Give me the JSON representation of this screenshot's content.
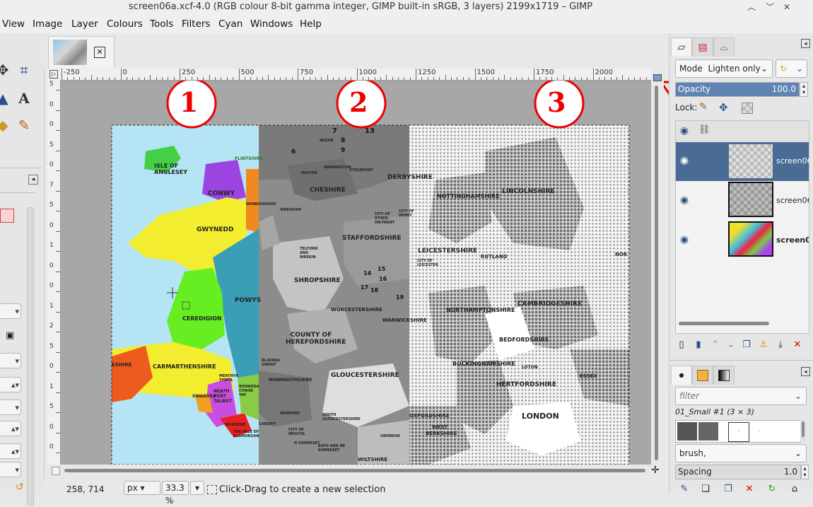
{
  "window": {
    "title": "screen06a.xcf-4.0 (RGB colour 8-bit gamma integer, GIMP built-in sRGB, 3 layers) 2199x1719 – GIMP",
    "buttons": [
      "︿",
      "﹀",
      "✕"
    ]
  },
  "menubar": [
    "View",
    "Image",
    "Layer",
    "Colours",
    "Tools",
    "Filters",
    "Cyan",
    "Windows",
    "Help"
  ],
  "ruler": {
    "h_ticks": [
      "-250",
      "0",
      "250",
      "500",
      "750",
      "1000",
      "1250",
      "1500",
      "1750",
      "2000",
      "2"
    ],
    "v_ticks": [
      "5",
      "0",
      "0",
      "5",
      "0",
      "7",
      "5",
      "0",
      "1",
      "0",
      "0",
      "1",
      "2",
      "5",
      "0",
      "1",
      "5",
      "0",
      "0"
    ]
  },
  "canvas": {
    "markers": [
      "1",
      "2",
      "3"
    ],
    "wales_labels": [
      "ISLE OF ANGLESEY",
      "CONWY",
      "GWYNEDD",
      "POWYS",
      "CEREDIGION",
      "CARMARTHENSHIRE",
      "FLINTSHIRE",
      "DENBIGHSHIRE",
      "SWANSEA",
      "NEATH PORT TALBOT",
      "RHONDDA CYNON TAF",
      "THE VALE OF GLAMORGAN",
      "BRIDGEND",
      "MERTHYR TYDFIL",
      "ESHIRE"
    ],
    "mid_labels": [
      "CHESHIRE",
      "DERBYSHIRE",
      "STAFFORDSHIRE",
      "SHROPSHIRE",
      "TELFORD AND WREKIN",
      "WORCESTERSHIRE",
      "WARWICKSHIRE",
      "COUNTY OF HEREFORDSHIRE",
      "GLOUCESTERSHIRE",
      "SOUTH GLOUCESTERSHIRE",
      "WILTSHIRE",
      "MONMOUTHSHIRE",
      "BLAENAU GWENT",
      "NEWPORT",
      "CARDIFF",
      "CITY OF BRISTOL",
      "BATH AND NE SOMERSET",
      "SWINDON",
      "WREXHAM",
      "HALTON",
      "WARRINGTON",
      "STOCKPORT",
      "WIGAN",
      "CITY OF STOKE-ON-TRENT",
      "CITY OF DERBY",
      "N SOMERSET"
    ],
    "mid_nums": [
      "7",
      "13",
      "8",
      "9",
      "6",
      "14",
      "15",
      "16",
      "17",
      "18",
      "19"
    ],
    "east_labels": [
      "LINCOLNSHIRE",
      "NOTTINGHAMSHIRE",
      "LEICESTERSHIRE",
      "RUTLAND",
      "CITY OF LEICESTER",
      "NORTHAMPTONSHIRE",
      "CAMBRIDGESHIRE",
      "BEDFORDSHIRE",
      "BUCKINGHAMSHIRE",
      "HERTFORDSHIRE",
      "OXFORDSHIRE",
      "LONDON",
      "WEST BERKSHIRE",
      "LUTON",
      "ESSEX",
      "NOR"
    ]
  },
  "statusbar": {
    "coords": "258, 714",
    "unit": "px",
    "zoom": "33.3 %",
    "message": "Click-Drag to create a new selection"
  },
  "dock": {
    "mode_label": "Mode",
    "mode_value": "Lighten only",
    "opacity_label": "Opacity",
    "opacity_value": "100.0",
    "opacity_fraction": 1.0,
    "lock_label": "Lock:",
    "layers": [
      {
        "name": "screen06",
        "selected": true,
        "visible": true
      },
      {
        "name": "screen06",
        "selected": false,
        "visible": true
      },
      {
        "name": "screen0",
        "selected": false,
        "visible": true
      }
    ],
    "brush_filter_placeholder": "filter",
    "brush_name": "01_Small #1 (3 × 3)",
    "brush_tag": "brush,",
    "spacing_label": "Spacing",
    "spacing_value": "1.0"
  },
  "colors": {
    "accent": "#4a6b93",
    "red": "#e00000",
    "selected_row": "#4a6b93"
  }
}
